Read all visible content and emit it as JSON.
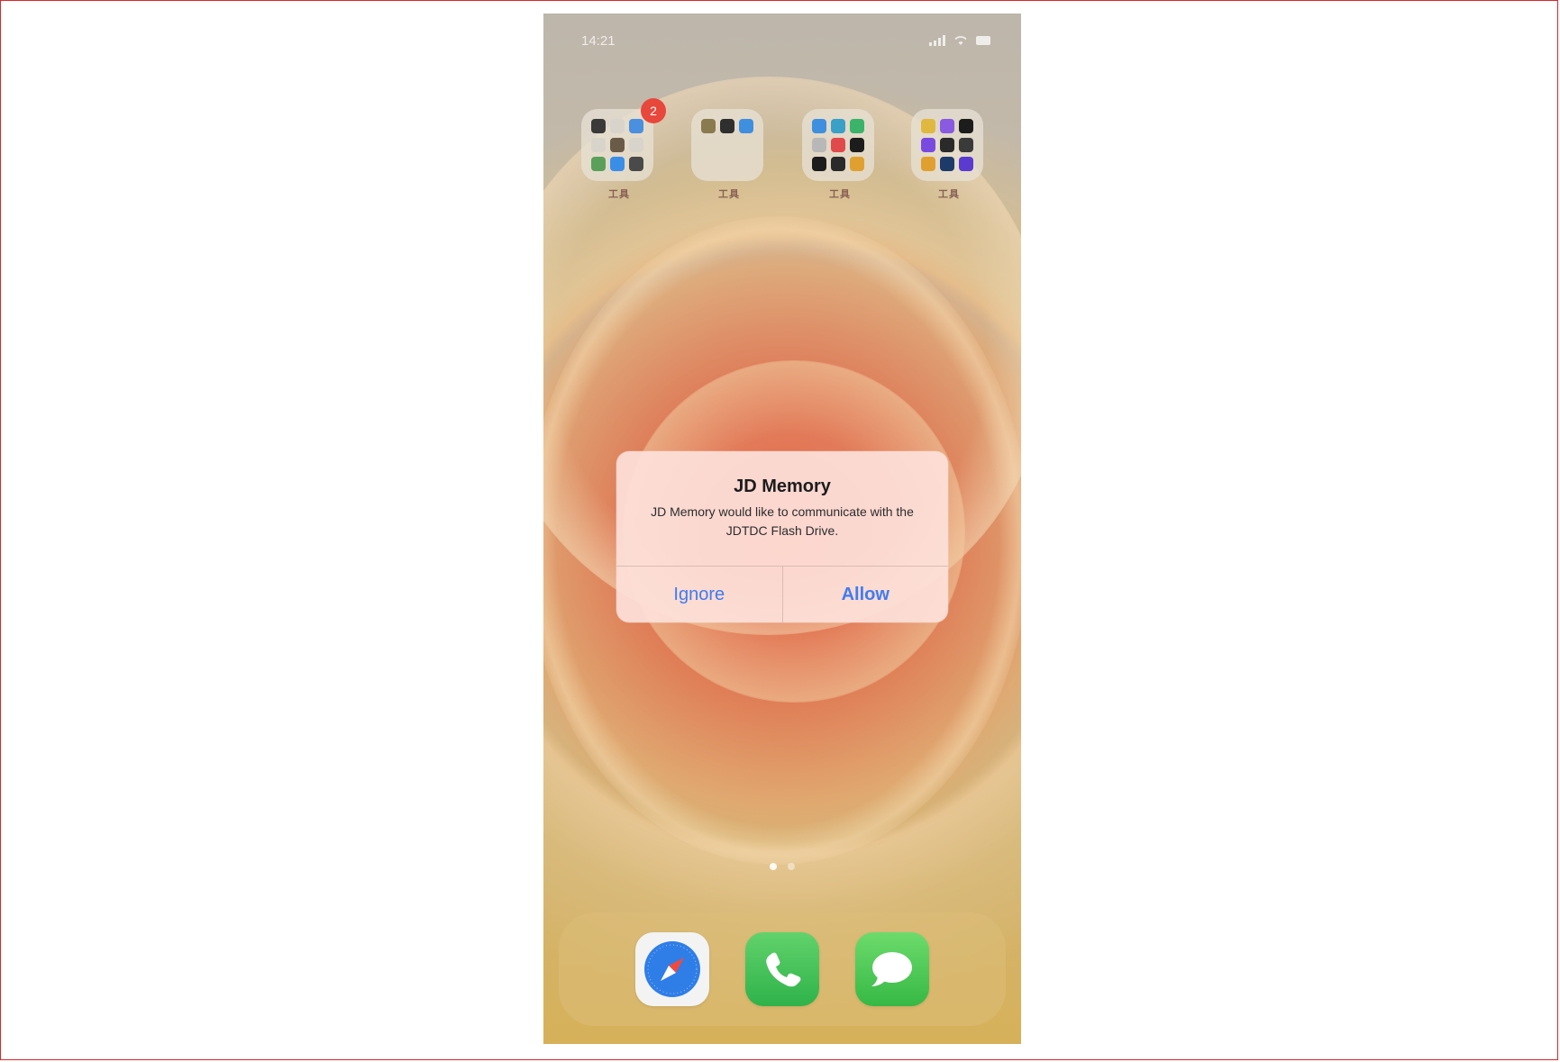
{
  "status_bar": {
    "time": "14:21"
  },
  "folders": [
    {
      "label": "工具",
      "badge": "2"
    },
    {
      "label": "工具",
      "badge": ""
    },
    {
      "label": "工具",
      "badge": ""
    },
    {
      "label": "工具",
      "badge": ""
    }
  ],
  "alert": {
    "title": "JD Memory",
    "message": "JD Memory would like to communicate with the JDTDC Flash Drive.",
    "ignore_label": "Ignore",
    "allow_label": "Allow",
    "button_color": "#3f7cf0"
  },
  "dock": {
    "apps": [
      {
        "name": "safari-icon"
      },
      {
        "name": "phone-icon"
      },
      {
        "name": "messages-icon"
      }
    ]
  },
  "page_indicator": {
    "pages": 2,
    "current": 1
  }
}
